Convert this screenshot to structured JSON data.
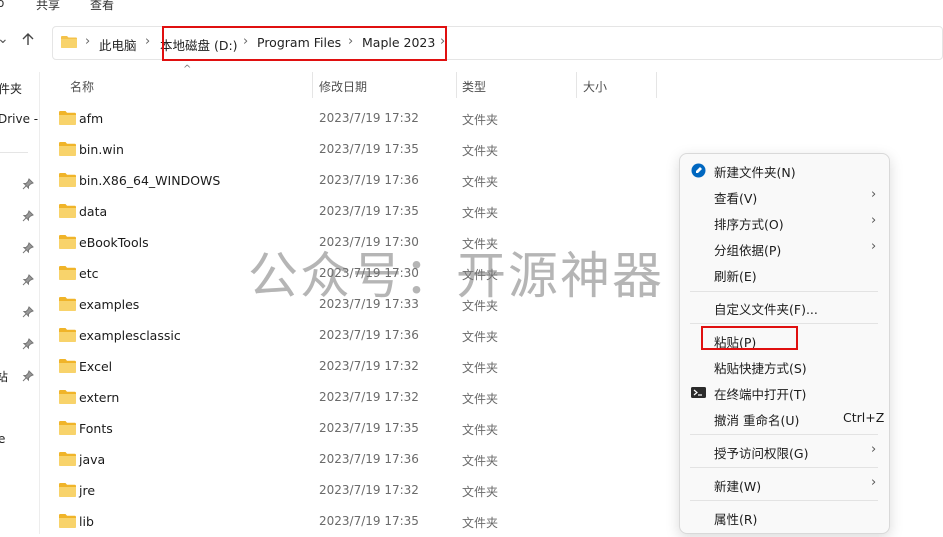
{
  "ribbon": {
    "tab_share": "共享",
    "tab_view": "查看"
  },
  "address": {
    "crumbs": [
      "此电脑",
      "本地磁盘 (D:)",
      "Program Files",
      "Maple 2023"
    ]
  },
  "sidebar": {
    "item_1": "件夹",
    "item_2": "Drive -",
    "item_3": "站",
    "item_4": "e"
  },
  "columns": {
    "name": "名称",
    "modified": "修改日期",
    "type": "类型",
    "size": "大小"
  },
  "files": [
    {
      "name": "afm",
      "modified": "2023/7/19 17:32",
      "type": "文件夹"
    },
    {
      "name": "bin.win",
      "modified": "2023/7/19 17:35",
      "type": "文件夹"
    },
    {
      "name": "bin.X86_64_WINDOWS",
      "modified": "2023/7/19 17:36",
      "type": "文件夹"
    },
    {
      "name": "data",
      "modified": "2023/7/19 17:35",
      "type": "文件夹"
    },
    {
      "name": "eBookTools",
      "modified": "2023/7/19 17:30",
      "type": "文件夹"
    },
    {
      "name": "etc",
      "modified": "2023/7/19 17:30",
      "type": "文件夹"
    },
    {
      "name": "examples",
      "modified": "2023/7/19 17:33",
      "type": "文件夹"
    },
    {
      "name": "examplesclassic",
      "modified": "2023/7/19 17:36",
      "type": "文件夹"
    },
    {
      "name": "Excel",
      "modified": "2023/7/19 17:32",
      "type": "文件夹"
    },
    {
      "name": "extern",
      "modified": "2023/7/19 17:32",
      "type": "文件夹"
    },
    {
      "name": "Fonts",
      "modified": "2023/7/19 17:35",
      "type": "文件夹"
    },
    {
      "name": "java",
      "modified": "2023/7/19 17:36",
      "type": "文件夹"
    },
    {
      "name": "jre",
      "modified": "2023/7/19 17:32",
      "type": "文件夹"
    },
    {
      "name": "lib",
      "modified": "2023/7/19 17:35",
      "type": "文件夹"
    }
  ],
  "watermark": "公众号：开源神器",
  "context_menu": {
    "new_folder": "新建文件夹(N)",
    "view": "查看(V)",
    "sort_by": "排序方式(O)",
    "group_by": "分组依据(P)",
    "refresh": "刷新(E)",
    "customize": "自定义文件夹(F)...",
    "paste": "粘贴(P)",
    "paste_shortcut": "粘贴快捷方式(S)",
    "open_terminal": "在终端中打开(T)",
    "undo_rename": "撤消 重命名(U)",
    "undo_shortcut": "Ctrl+Z",
    "give_access": "授予访问权限(G)",
    "new": "新建(W)",
    "properties": "属性(R)"
  },
  "colors": {
    "highlight_box": "#e01010",
    "folder": "#f4c24a",
    "accent": "#0067c0"
  },
  "icons": [
    "folder-icon",
    "pin-icon",
    "chevron-right-icon",
    "up-arrow-icon",
    "new-folder-icon",
    "terminal-icon"
  ]
}
